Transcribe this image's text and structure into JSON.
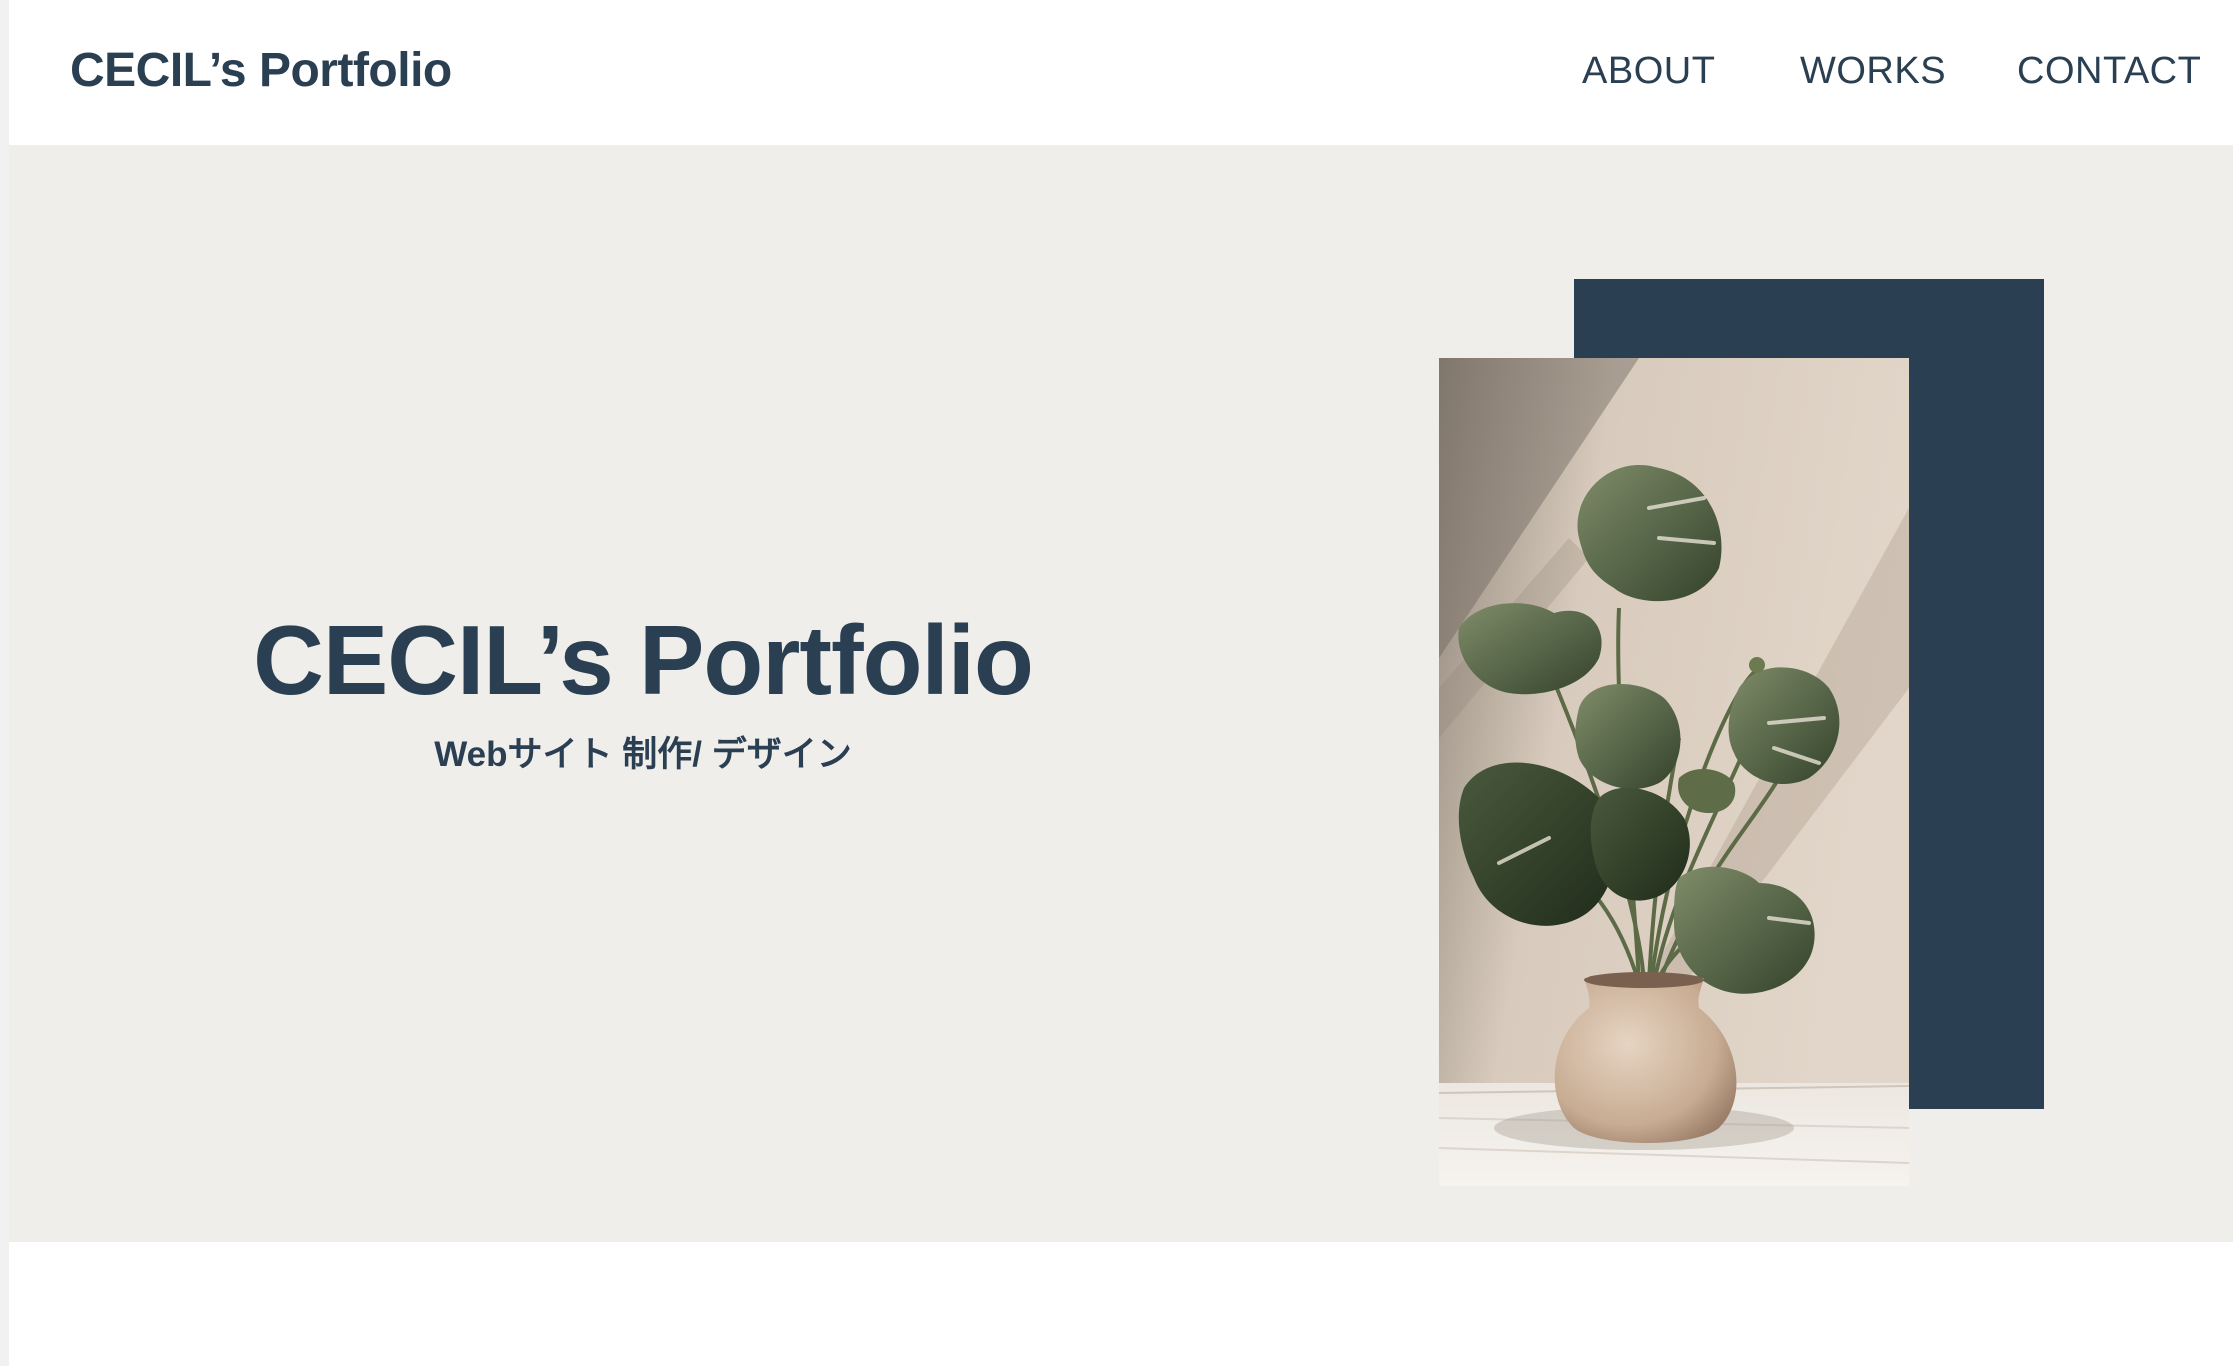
{
  "header": {
    "brand": "CECIL’s Portfolio",
    "nav": [
      {
        "label": "ABOUT"
      },
      {
        "label": "WORKS"
      },
      {
        "label": "CONTACT"
      }
    ]
  },
  "hero": {
    "title": "CECIL’s Portfolio",
    "subtitle": "Webサイト 制作/ デザイン",
    "image_icon": "potted-plant-photo"
  },
  "colors": {
    "navy": "#2a3f52",
    "hero_bg": "#efeeeb",
    "header_bg": "#ffffff"
  }
}
